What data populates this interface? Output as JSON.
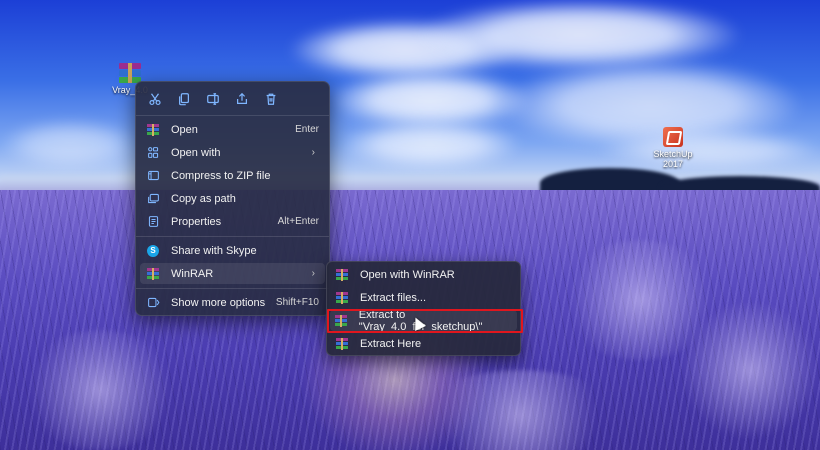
{
  "desktop": {
    "icons": [
      {
        "label": "Vray_4.0",
        "icon": "winrar-archive-icon"
      },
      {
        "label": "SketchUp\n2017",
        "label_line1": "SketchUp",
        "label_line2": "2017",
        "icon": "sketchup-icon"
      }
    ]
  },
  "context_menu": {
    "toolbar": [
      {
        "action": "cut",
        "icon": "scissors-icon"
      },
      {
        "action": "copy",
        "icon": "copy-icon"
      },
      {
        "action": "rename",
        "icon": "rename-icon"
      },
      {
        "action": "share",
        "icon": "share-icon"
      },
      {
        "action": "delete",
        "icon": "trash-icon"
      }
    ],
    "items": [
      {
        "label": "Open",
        "shortcut": "Enter",
        "icon": "winrar-icon"
      },
      {
        "label": "Open with",
        "submenu": true,
        "icon": "open-with-icon"
      },
      {
        "label": "Compress to ZIP file",
        "icon": "zip-icon"
      },
      {
        "label": "Copy as path",
        "icon": "copy-path-icon"
      },
      {
        "label": "Properties",
        "shortcut": "Alt+Enter",
        "icon": "properties-icon"
      },
      {
        "label": "Share with Skype",
        "icon": "skype-icon"
      },
      {
        "label": "WinRAR",
        "submenu": true,
        "icon": "winrar-icon"
      },
      {
        "label": "Show more options",
        "shortcut": "Shift+F10",
        "icon": "more-options-icon"
      }
    ],
    "arrow_glyph": "›"
  },
  "winrar_submenu": {
    "items": [
      {
        "label": "Open with WinRAR"
      },
      {
        "label": "Extract files..."
      },
      {
        "label": "Extract to \"Vray_4.0_for_sketchup\\\""
      },
      {
        "label": "Extract Here"
      }
    ],
    "highlighted_index": 2,
    "highlight_color": "#e0161e"
  },
  "skype_letter": "S"
}
